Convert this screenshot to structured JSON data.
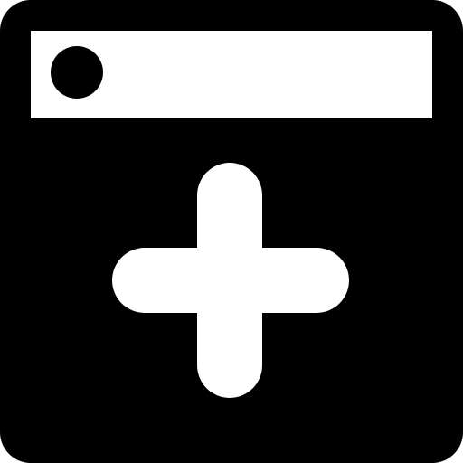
{
  "icon": {
    "name": "new-window-icon",
    "foreground": "#000000",
    "background": "#ffffff",
    "parts": {
      "frame": "window-frame",
      "title_bar": "title-bar",
      "title_dot": "title-bar-dot",
      "plus": "plus-icon"
    }
  }
}
